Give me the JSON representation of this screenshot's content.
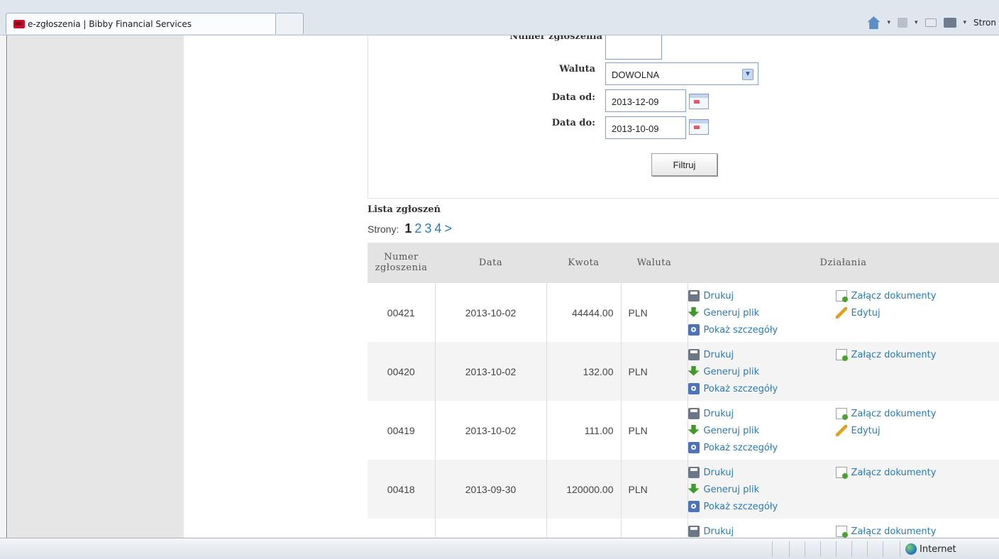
{
  "browser": {
    "tab_title": "e-zgłoszenia | Bibby Financial Services",
    "command_bar_label": "Stron",
    "status_zone": "Internet"
  },
  "filter": {
    "partial_label": "Numer zgłoszenia",
    "currency_label": "Waluta",
    "currency_value": "DOWOLNA",
    "date_from_label": "Data od:",
    "date_from_value": "2013-12-09",
    "date_to_label": "Data do:",
    "date_to_value": "2013-10-09",
    "filter_button": "Filtruj"
  },
  "list": {
    "title": "Lista zgłoszeń",
    "pages_label": "Strony:",
    "current_page": "1",
    "pages": [
      "2",
      "3",
      "4",
      ">"
    ],
    "columns": {
      "number": "Numer zgłoszenia",
      "date": "Data",
      "amount": "Kwota",
      "currency": "Waluta",
      "actions": "Działania"
    },
    "actions": {
      "print": "Drukuj",
      "generate": "Generuj plik",
      "details": "Pokaż szczegóły",
      "attach": "Załącz dokumenty",
      "edit": "Edytuj"
    },
    "rows": [
      {
        "number": "00421",
        "date": "2013-10-02",
        "amount": "44444.00",
        "currency": "PLN"
      },
      {
        "number": "00420",
        "date": "2013-10-02",
        "amount": "132.00",
        "currency": "PLN"
      },
      {
        "number": "00419",
        "date": "2013-10-02",
        "amount": "111.00",
        "currency": "PLN"
      },
      {
        "number": "00418",
        "date": "2013-09-30",
        "amount": "120000.00",
        "currency": "PLN"
      },
      {
        "number": "",
        "date": "",
        "amount": "",
        "currency": ""
      }
    ]
  }
}
